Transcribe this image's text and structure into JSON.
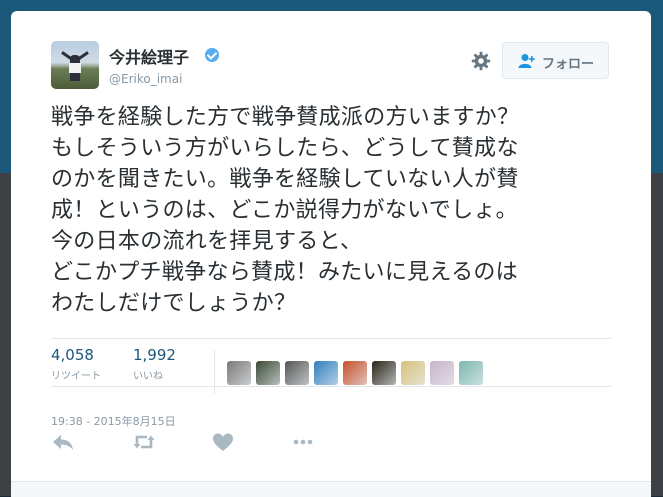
{
  "user": {
    "display_name": "今井絵理子",
    "handle": "@Eriko_imai",
    "verified": true
  },
  "actions_top": {
    "settings_icon": "gear-icon",
    "follow_icon": "add-user-icon",
    "follow_label": "フォロー"
  },
  "tweet": {
    "text": "戦争を経験した方で戦争賛成派の方いますか？\nもしそういう方がいらしたら、どうして賛成な\nのかを聞きたい。戦争を経験していない人が賛\n成！というのは、どこか説得力がないでしょ。\n今の日本の流れを拝見すると、\nどこかプチ戦争なら賛成！みたいに見えるのは\nわたしだけでしょうか？"
  },
  "stats": {
    "retweets_count": "4,058",
    "retweets_label": "リツイート",
    "likes_count": "1,992",
    "likes_label": "いいね"
  },
  "likers": [
    {
      "name": "liker-avatar-1",
      "color": "#7a7a7a"
    },
    {
      "name": "liker-avatar-2",
      "color": "#3a4a35"
    },
    {
      "name": "liker-avatar-3",
      "color": "#555555"
    },
    {
      "name": "liker-avatar-4",
      "color": "#2f7fc0"
    },
    {
      "name": "liker-avatar-5",
      "color": "#c7502c"
    },
    {
      "name": "liker-avatar-6",
      "color": "#2a2418"
    },
    {
      "name": "liker-avatar-7",
      "color": "#d8c27a"
    },
    {
      "name": "liker-avatar-8",
      "color": "#c9b3c8"
    },
    {
      "name": "liker-avatar-9",
      "color": "#7cb9b0"
    }
  ],
  "timestamp": "19:38 - 2015年8月15日",
  "actions_bottom": [
    "reply-icon",
    "retweet-icon",
    "like-icon",
    "more-icon"
  ],
  "colors": {
    "header_band": "#1b5879",
    "stat_number": "#1b5879",
    "verified_badge": "#55acee",
    "muted_text": "#8899a6"
  }
}
